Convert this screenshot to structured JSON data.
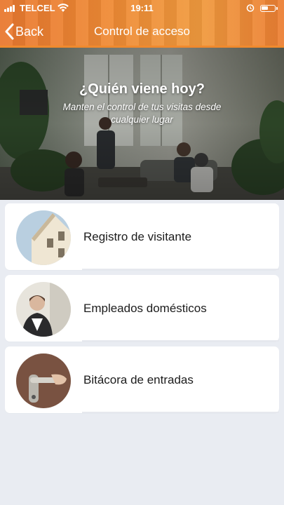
{
  "status_bar": {
    "carrier": "TELCEL",
    "time": "19:11"
  },
  "nav": {
    "back_label": "Back",
    "title": "Control de acceso"
  },
  "hero": {
    "title": "¿Quién viene hoy?",
    "subtitle": "Manten el control de tus visitas desde cualquier lugar"
  },
  "menu": {
    "items": [
      {
        "label": "Registro de visitante",
        "image": "house-photo"
      },
      {
        "label": "Empleados domésticos",
        "image": "housekeeper-photo"
      },
      {
        "label": "Bitácora de entradas",
        "image": "door-handle-photo"
      }
    ]
  },
  "colors": {
    "header_orange": "#ef8b35",
    "background": "#e9ecf2",
    "card": "#ffffff",
    "text": "#1c1c1c"
  }
}
